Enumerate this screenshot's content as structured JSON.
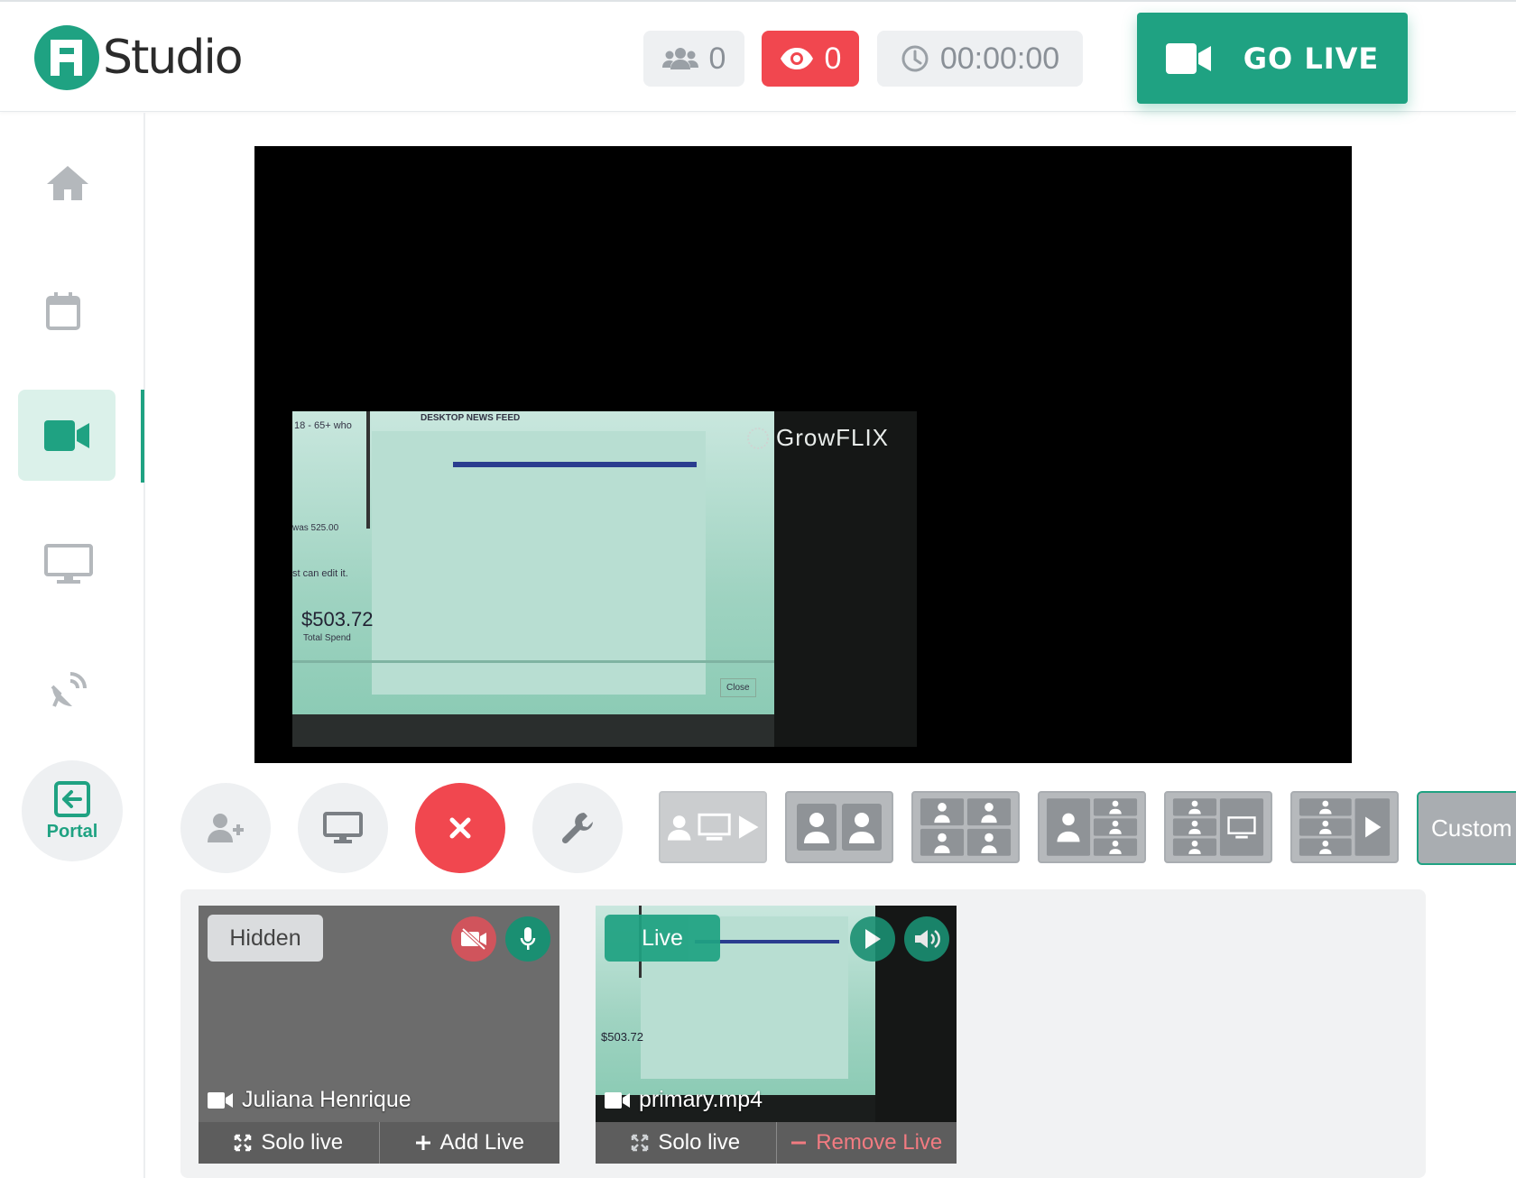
{
  "brand": {
    "logo_text": "Studio",
    "accent": "#1fa282",
    "danger": "#f1474f"
  },
  "header": {
    "participants": "0",
    "viewers": "0",
    "timer": "00:00:00",
    "go_live": "GO LIVE"
  },
  "sidebar": {
    "items": [
      {
        "name": "home-icon"
      },
      {
        "name": "calendar-icon"
      },
      {
        "name": "video-camera-icon"
      },
      {
        "name": "monitor-icon"
      },
      {
        "name": "satellite-dish-icon"
      }
    ],
    "portal_label": "Portal"
  },
  "preview": {
    "brand_text": "GrowFLIX",
    "overlay_lines": [
      "DESKTOP NEWS FEED",
      "18 - 65+ who",
      "was 525.00",
      "st can edit it.",
      "$503.72",
      "Total Spend",
      "Close"
    ]
  },
  "layouts": {
    "custom_label": "Custom"
  },
  "sources": [
    {
      "status": "Hidden",
      "name": "Juliana Henrique",
      "primary_action": "Solo live",
      "secondary_action": "Add Live"
    },
    {
      "status": "Live",
      "name": "primary.mp4",
      "primary_action": "Solo live",
      "secondary_action": "Remove Live"
    }
  ]
}
